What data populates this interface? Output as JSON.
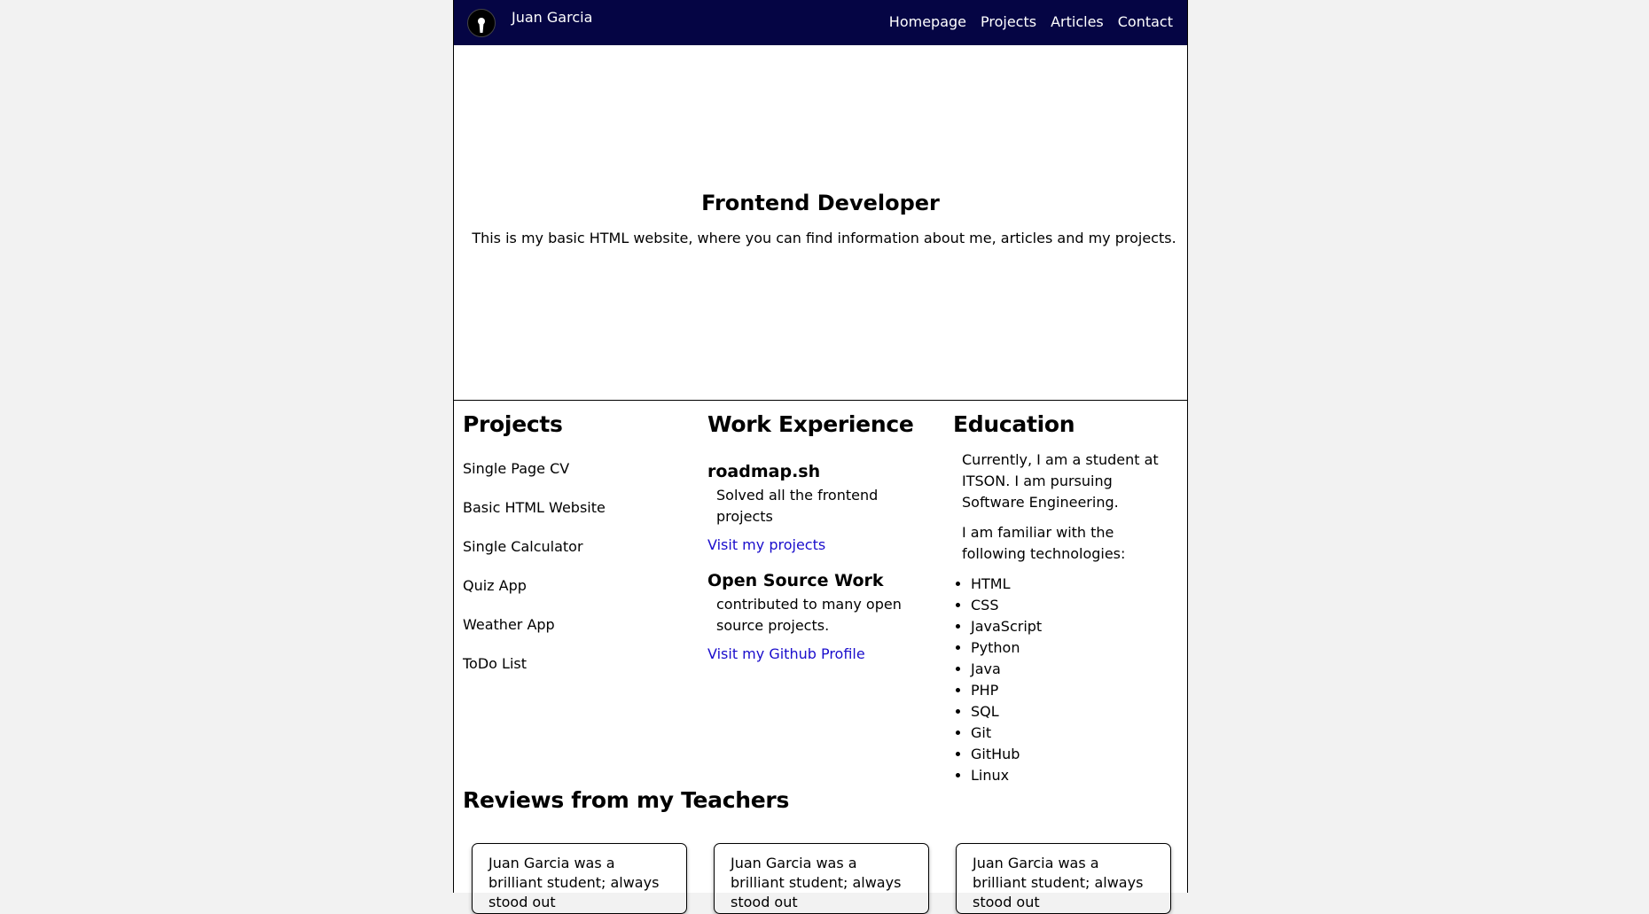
{
  "header": {
    "brand": "Juan Garcia",
    "avatar_icon": "keyhole-avatar-icon",
    "nav": [
      "Homepage",
      "Projects",
      "Articles",
      "Contact"
    ],
    "bg_color": "#050544"
  },
  "hero": {
    "title": "Frontend Developer",
    "subtitle": "This is my basic HTML website, where you can find information about me, articles and my projects."
  },
  "projects": {
    "title": "Projects",
    "items": [
      "Single Page CV",
      "Basic HTML Website",
      "Single Calculator",
      "Quiz App",
      "Weather App",
      "ToDo List"
    ]
  },
  "work": {
    "title": "Work Experience",
    "entries": [
      {
        "name": "roadmap.sh",
        "desc": "Solved all the frontend projects",
        "link": "Visit my projects"
      },
      {
        "name": "Open Source Work",
        "desc": "contributed to many open source projects.",
        "link": "Visit my Github Profile"
      }
    ]
  },
  "education": {
    "title": "Education",
    "p1": "Currently, I am a student at ITSON. I am pursuing Software Engineering.",
    "p2": "I am familiar with the following technologies:",
    "tech": [
      "HTML",
      "CSS",
      "JavaScript",
      "Python",
      "Java",
      "PHP",
      "SQL",
      "Git",
      "GitHub",
      "Linux"
    ]
  },
  "reviews": {
    "title": "Reviews from my Teachers",
    "cards": [
      "Juan Garcia was a brilliant student; always stood out",
      "Juan Garcia was a brilliant student; always stood out",
      "Juan Garcia was a brilliant student; always stood out"
    ]
  }
}
